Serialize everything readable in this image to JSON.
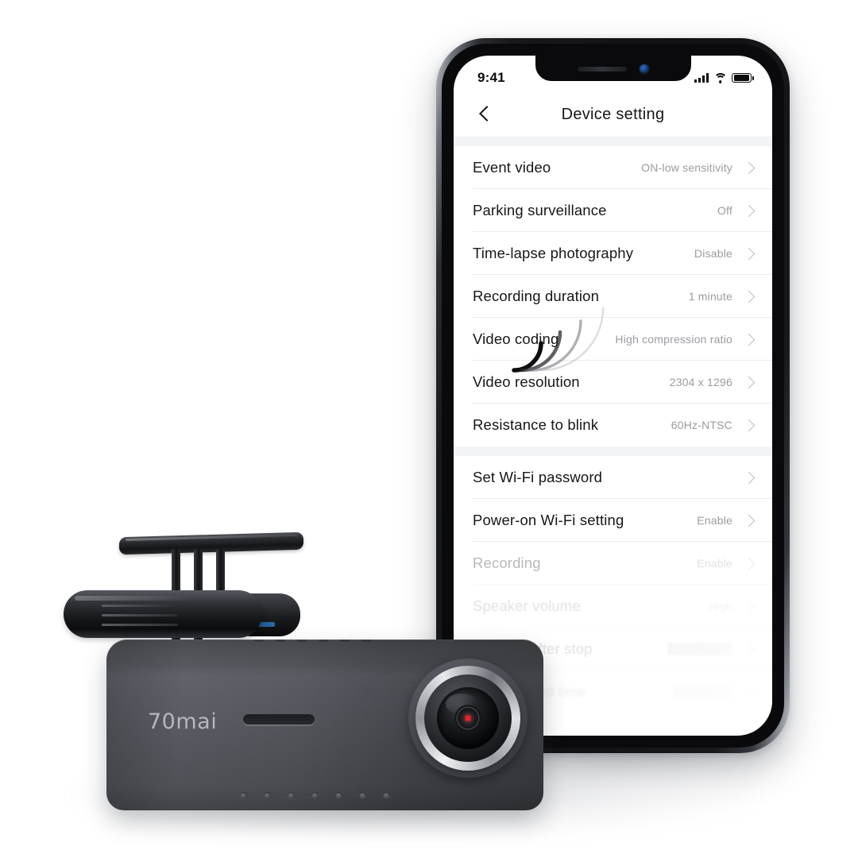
{
  "status_bar": {
    "time": "9:41",
    "signal_icon": "cellular-signal-icon",
    "wifi_icon": "wifi-icon",
    "battery_icon": "battery-full-icon"
  },
  "nav": {
    "back_icon": "chevron-left-icon",
    "title": "Device setting"
  },
  "sections": [
    {
      "id": "recording-settings",
      "rows": [
        {
          "label": "Event video",
          "value": "ON-low sensitivity",
          "chevron": "chevron-right-icon"
        },
        {
          "label": "Parking surveillance",
          "value": "Off",
          "chevron": "chevron-right-icon"
        },
        {
          "label": "Time-lapse photography",
          "value": "Disable",
          "chevron": "chevron-right-icon"
        },
        {
          "label": "Recording duration",
          "value": "1 minute",
          "chevron": "chevron-right-icon"
        },
        {
          "label": "Video coding",
          "value": "High compression ratio",
          "chevron": "chevron-right-icon"
        },
        {
          "label": "Video resolution",
          "value": "2304 x 1296",
          "chevron": "chevron-right-icon"
        },
        {
          "label": "Resistance to blink",
          "value": "60Hz-NTSC",
          "chevron": "chevron-right-icon"
        }
      ]
    },
    {
      "id": "wifi-and-device-settings",
      "rows": [
        {
          "label": "Set Wi-Fi password",
          "value": "",
          "chevron": "chevron-right-icon"
        },
        {
          "label": "Power-on Wi-Fi setting",
          "value": "Enable",
          "chevron": "chevron-right-icon"
        },
        {
          "label": "Recording",
          "value": "Enable",
          "chevron": "chevron-right-icon"
        },
        {
          "label": "Speaker volume",
          "value": "High",
          "chevron": "chevron-right-icon"
        },
        {
          "label": "after stop",
          "value": "",
          "chevron": "chevron-right-icon"
        },
        {
          "label": "sed time",
          "value": "",
          "chevron": "chevron-right-icon"
        }
      ]
    }
  ],
  "overlay": {
    "sound_wave_icon": "sound-wave-icon"
  },
  "device": {
    "brand_logo": "70mai",
    "lens_icon": "camera-lens-icon",
    "mic_slot_icon": "microphone-slot-icon",
    "mount_icon": "windshield-mount-icon"
  },
  "colors": {
    "background": "#ffffff",
    "screen": "#ffffff",
    "phone_frame": "#111214",
    "label_text": "#16171a",
    "value_text": "#9a9ba0",
    "separator": "#ececee",
    "section_band": "#f3f4f7",
    "lens_indicator": "#e2252a"
  }
}
